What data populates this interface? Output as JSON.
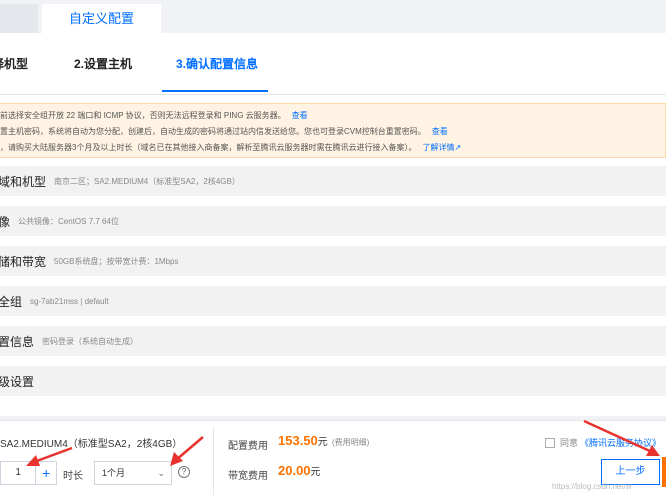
{
  "tabs": {
    "prev_label": "",
    "active_label": "自定义配置"
  },
  "steps": [
    {
      "label": "择机型"
    },
    {
      "label": "2.设置主机"
    },
    {
      "label": "3.确认配置信息"
    }
  ],
  "notice": {
    "lines": [
      {
        "text": "前选择安全组开放 22 端口和 ICMP 协议，否则无法远程登录和 PING 云服务器。",
        "link": "查看"
      },
      {
        "text": "置主机密码，系统将自动为您分配，创建后，自动生成的密码将通过站内信发送给您。您也可登录CVM控制台重置密码。",
        "link": "查看"
      },
      {
        "text": "，请购买大陆服务器3个月及以上时长（域名已在其他接入商备案，解析至腾讯云服务器时需在腾讯云进行接入备案）。",
        "link": "了解详情"
      }
    ]
  },
  "summary_rows": [
    {
      "title": "域和机型",
      "detail": "南京二区；SA2.MEDIUM4（标准型SA2，2核4GB）"
    },
    {
      "title": "像",
      "detail": "公共镜像：CentOS 7.7 64位"
    },
    {
      "title": "储和带宽",
      "detail": "50GB系统盘；按带宽计费：1Mbps"
    },
    {
      "title": "全组",
      "detail": "sg-7ab21mss | default"
    },
    {
      "title": "置信息",
      "detail": "密码登录（系统自动生成）"
    },
    {
      "title": "级设置",
      "detail": ""
    }
  ],
  "footer": {
    "config_text": "SA2.MEDIUM4（标准型SA2，2核4GB）",
    "quantity": "1",
    "plus": "+",
    "duration_label": "时长",
    "duration_value": "1个月",
    "help": "?",
    "config_fee_label": "配置费用",
    "config_fee_amount": "153.50",
    "config_fee_unit": "元",
    "fee_detail_link": "(费用明细)",
    "band_fee_label": "带宽费用",
    "band_fee_amount": "20.00",
    "band_fee_unit": "元",
    "agree_text": "同意",
    "agree_link": "《腾讯云服务协议》",
    "prev_button": "上一步"
  },
  "watermark": "https://blog.csdn.net/w",
  "colors": {
    "accent": "#006eff",
    "price": "#ff7200",
    "arrow": "#e8322d",
    "notice_bg": "#fff4e3"
  }
}
